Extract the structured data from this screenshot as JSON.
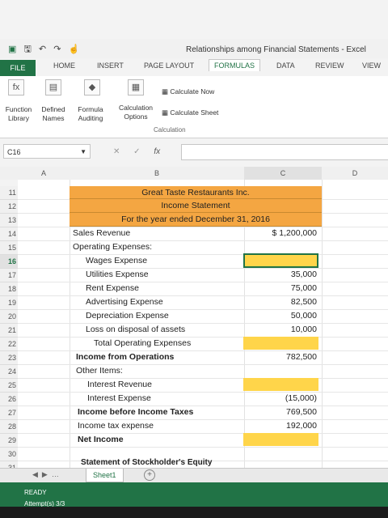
{
  "window": {
    "title": "Relationships among Financial Statements - Excel"
  },
  "tabs": [
    "FILE",
    "HOME",
    "INSERT",
    "PAGE LAYOUT",
    "FORMULAS",
    "DATA",
    "REVIEW",
    "VIEW"
  ],
  "ribbon": {
    "insert_function": "Function Library",
    "defined_names": "Defined Names",
    "formula_auditing": "Formula Auditing",
    "calc_options": "Calculation Options",
    "calc_now": "Calculate Now",
    "calc_sheet": "Calculate Sheet",
    "group_calculation": "Calculation"
  },
  "formula_bar": {
    "name_box": "C16",
    "fx": "fx",
    "value": ""
  },
  "columns": [
    "A",
    "B",
    "C",
    "D"
  ],
  "rows": [
    "11",
    "12",
    "13",
    "14",
    "15",
    "16",
    "17",
    "18",
    "19",
    "20",
    "21",
    "22",
    "23",
    "24",
    "25",
    "26",
    "27",
    "28",
    "29",
    "30",
    "31"
  ],
  "statement": {
    "company": "Great Taste Restaurants Inc.",
    "title": "Income Statement",
    "period": "For the year ended December 31, 2016",
    "lines": [
      {
        "label": "Sales Revenue",
        "value": "$      1,200,000",
        "bold": false
      },
      {
        "label": "Operating Expenses:",
        "value": "",
        "bold": false
      },
      {
        "label": "Wages Expense",
        "value": "",
        "bold": false
      },
      {
        "label": "Utilities Expense",
        "value": "35,000",
        "bold": false
      },
      {
        "label": "Rent Expense",
        "value": "75,000",
        "bold": false
      },
      {
        "label": "Advertising Expense",
        "value": "82,500",
        "bold": false
      },
      {
        "label": "Depreciation Expense",
        "value": "50,000",
        "bold": false
      },
      {
        "label": "Loss on disposal of assets",
        "value": "10,000",
        "bold": false
      },
      {
        "label": "Total Operating Expenses",
        "value": "",
        "bold": false
      },
      {
        "label": "Income from Operations",
        "value": "782,500",
        "bold": true
      },
      {
        "label": "Other Items:",
        "value": "",
        "bold": false
      },
      {
        "label": "Interest Revenue",
        "value": "",
        "bold": false
      },
      {
        "label": "Interest Expense",
        "value": "(15,000)",
        "bold": false
      },
      {
        "label": "Income before Income Taxes",
        "value": "769,500",
        "bold": true
      },
      {
        "label": "Income tax expense",
        "value": "192,000",
        "bold": false
      },
      {
        "label": "Net Income",
        "value": "",
        "bold": true
      }
    ],
    "next_heading": "Statement of Stockholder's Equity"
  },
  "sheet_tab": "Sheet1",
  "status": {
    "ready": "READY",
    "attempt": "Attempt(s)    3/3"
  }
}
